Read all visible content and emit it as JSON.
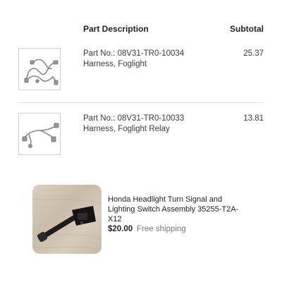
{
  "table": {
    "headers": {
      "description": "Part Description",
      "subtotal": "Subtotal"
    },
    "rows": [
      {
        "part_no": "Part No.: 08V31-TR0-10034",
        "name": "Harness, Foglight",
        "subtotal": "25.37",
        "image_icon": "wiring-harness-icon"
      },
      {
        "part_no": "Part No.: 08V31-TR0-10033",
        "name": "Harness, Foglight Relay",
        "subtotal": "13.81",
        "image_icon": "wiring-harness-icon"
      }
    ]
  },
  "listing": {
    "title": "Honda Headlight Turn Signal and Lighting Switch Assembly 35255-T2A-X12",
    "price": "$20.00",
    "shipping": "Free shipping",
    "image_icon": "turn-signal-switch-photo"
  }
}
